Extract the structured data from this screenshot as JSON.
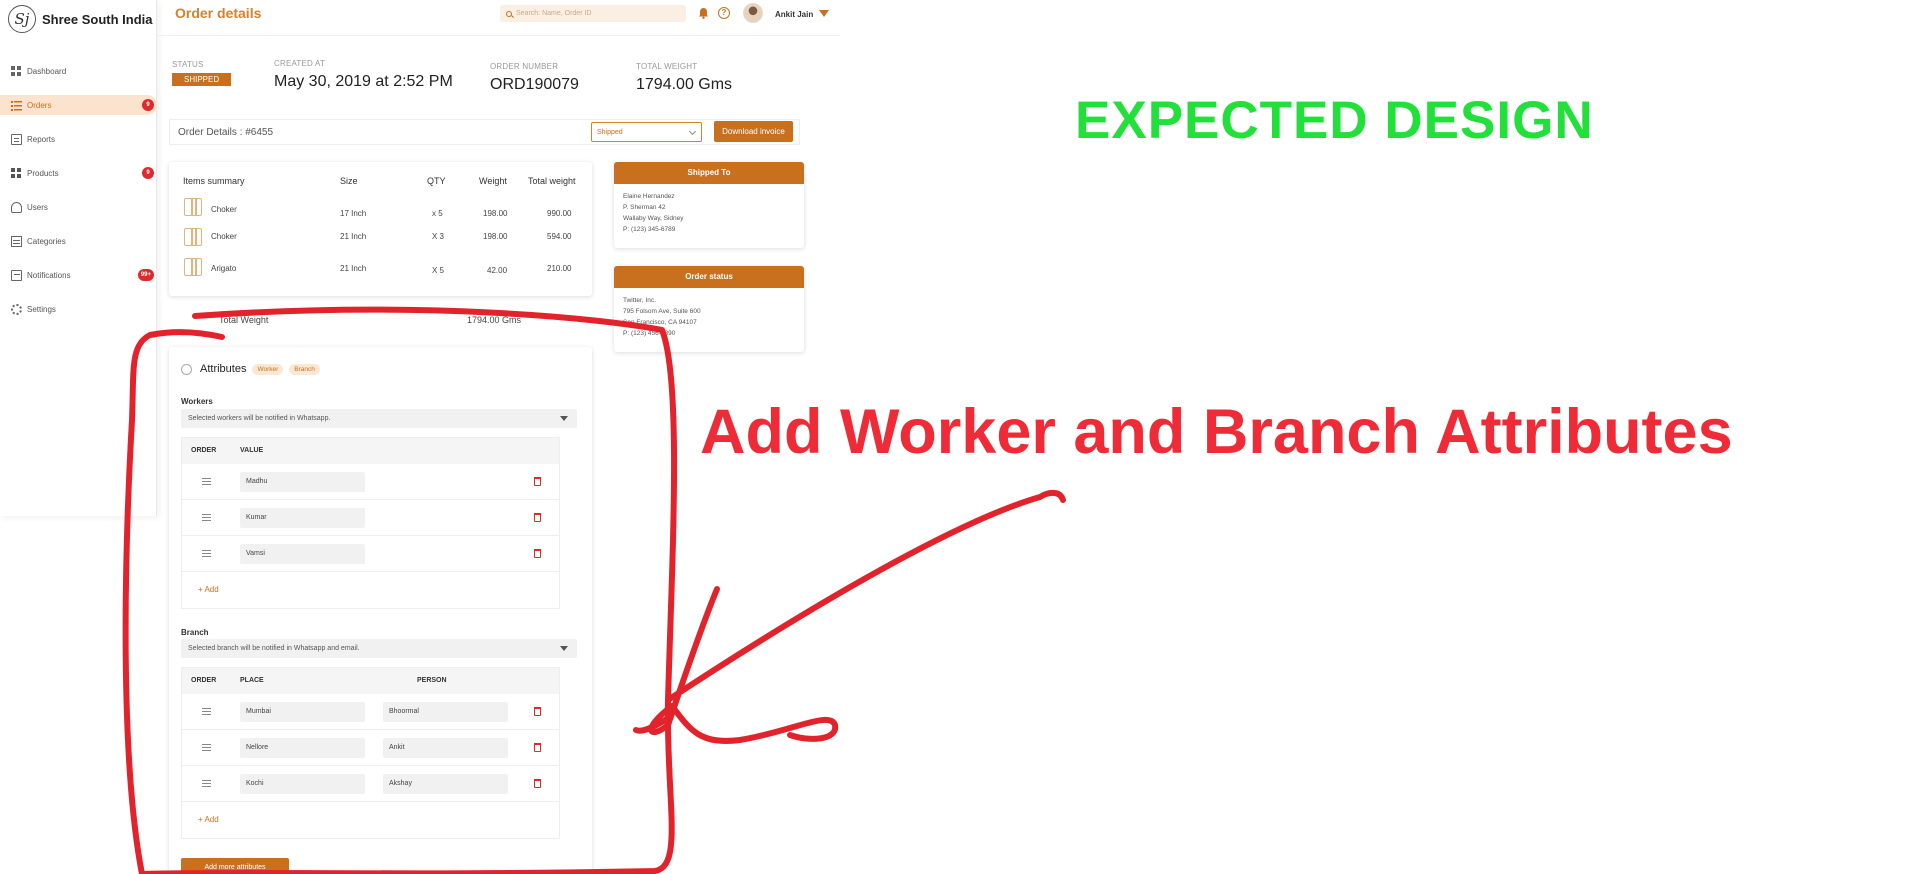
{
  "brand": {
    "name": "Shree South India",
    "logo_letter": "Sj"
  },
  "sidebar": {
    "items": [
      {
        "label": "Dashboard",
        "icon": "dashboard-icon",
        "badge": ""
      },
      {
        "label": "Orders",
        "icon": "list-icon",
        "badge": "9",
        "active": true
      },
      {
        "label": "Reports",
        "icon": "report-icon",
        "badge": ""
      },
      {
        "label": "Products",
        "icon": "grid-icon",
        "badge": "9"
      },
      {
        "label": "Users",
        "icon": "users-icon",
        "badge": ""
      },
      {
        "label": "Categories",
        "icon": "category-icon",
        "badge": ""
      },
      {
        "label": "Notifications",
        "icon": "notification-icon",
        "badge": "99+"
      },
      {
        "label": "Settings",
        "icon": "gear-icon",
        "badge": ""
      }
    ]
  },
  "header": {
    "title": "Order details",
    "search_placeholder": "Search: Name, Order ID",
    "user_name": "Ankit Jain"
  },
  "summary": {
    "status_label": "STATUS",
    "status_value": "SHIPPED",
    "created_label": "CREATED AT",
    "created_value": "May 30, 2019 at 2:52 PM",
    "order_label": "ORDER NUMBER",
    "order_value": "ORD190079",
    "weight_label": "TOTAL WEIGHT",
    "weight_value": "1794.00 Gms"
  },
  "details_bar": {
    "title": "Order Details : #6455",
    "status_select": "Shipped",
    "download_label": "Download invoice"
  },
  "items": {
    "headers": [
      "Items summary",
      "Size",
      "QTY",
      "Weight",
      "Total weight"
    ],
    "rows": [
      {
        "name": "Choker",
        "size": "17 Inch",
        "qty": "x 5",
        "weight": "198.00",
        "total": "990.00"
      },
      {
        "name": "Choker",
        "size": "21 Inch",
        "qty": "X 3",
        "weight": "198.00",
        "total": "594.00"
      },
      {
        "name": "Arigato",
        "size": "21 Inch",
        "qty": "X 5",
        "weight": "42.00",
        "total": "210.00"
      }
    ]
  },
  "total_peek": {
    "label": "Total Weight",
    "value": "1794.00 Gms"
  },
  "shipped_to": {
    "title": "Shipped To",
    "lines": [
      "Elaine Hernandez",
      "P. Sherman 42",
      "Wallaby Way, Sidney",
      "P: (123) 345-6789"
    ]
  },
  "order_status": {
    "title": "Order status",
    "lines": [
      "Twitter, Inc.",
      "795 Folsom Ave, Suite 600",
      "San Francisco, CA 94107",
      "P: (123) 456-7890"
    ]
  },
  "attributes": {
    "title": "Attributes",
    "chips": [
      "Worker",
      "Branch"
    ],
    "workers": {
      "label": "Workers",
      "select": "Selected workers will be notified in Whatsapp.",
      "headers": [
        "ORDER",
        "VALUE"
      ],
      "rows": [
        "Madhu",
        "Kumar",
        "Vamsi"
      ],
      "add_label": "+ Add"
    },
    "branch": {
      "label": "Branch",
      "select": "Selected branch will be notified in Whatsapp and email.",
      "headers": [
        "ORDER",
        "PLACE",
        "PERSON"
      ],
      "rows": [
        {
          "place": "Mumbai",
          "person": "Bhoormal"
        },
        {
          "place": "Nellore",
          "person": "Ankit"
        },
        {
          "place": "Kochi",
          "person": "Akshay"
        }
      ],
      "add_label": "+ Add"
    },
    "add_more_label": "Add more attributes"
  },
  "annotations": {
    "expected": "EXPECTED DESIGN",
    "note": "Add Worker and Branch Attributes",
    "expected_color": "#22e03a",
    "note_color": "#ee2b36"
  },
  "colors": {
    "accent": "#c9701e",
    "badge": "#e0292c"
  }
}
